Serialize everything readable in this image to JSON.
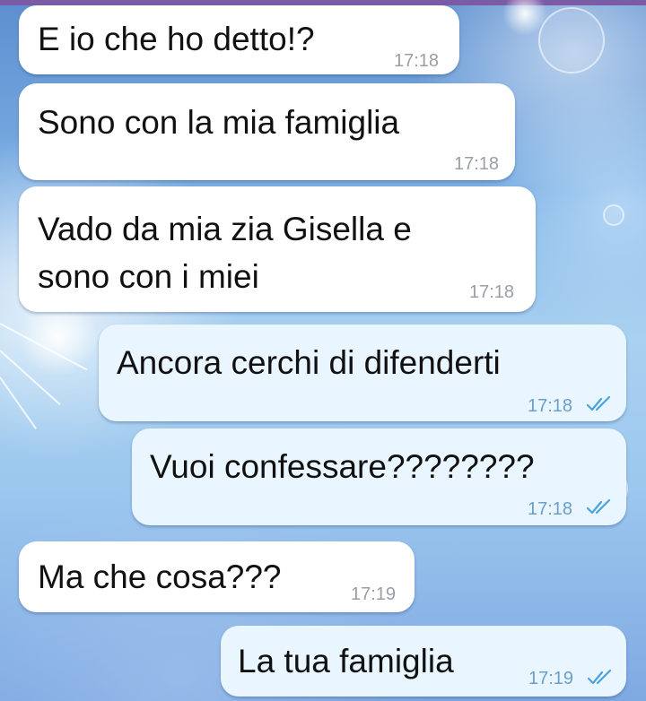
{
  "messages": [
    {
      "direction": "incoming",
      "text": "E io che ho detto!?",
      "time": "17:18"
    },
    {
      "direction": "incoming",
      "text": "Sono con la mia famiglia",
      "time": "17:18"
    },
    {
      "direction": "incoming",
      "lines": [
        "Vado da mia zia Gisella e",
        "sono con i miei"
      ],
      "time": "17:18"
    },
    {
      "direction": "outgoing",
      "text": "Ancora cerchi di difenderti",
      "time": "17:18",
      "status_icon": "double-check-icon"
    },
    {
      "direction": "outgoing",
      "text": "Vuoi confessare????????",
      "time": "17:18",
      "status_icon": "double-check-icon"
    },
    {
      "direction": "incoming",
      "text": "Ma che cosa???",
      "time": "17:19"
    },
    {
      "direction": "outgoing",
      "text": "La tua famiglia",
      "time": "17:19",
      "status_icon": "double-check-icon"
    }
  ],
  "colors": {
    "incoming_bubble": "#ffffff",
    "outgoing_bubble": "#e9f6ff",
    "read_check": "#4aa3df",
    "top_strip": "#7b5aa6"
  }
}
